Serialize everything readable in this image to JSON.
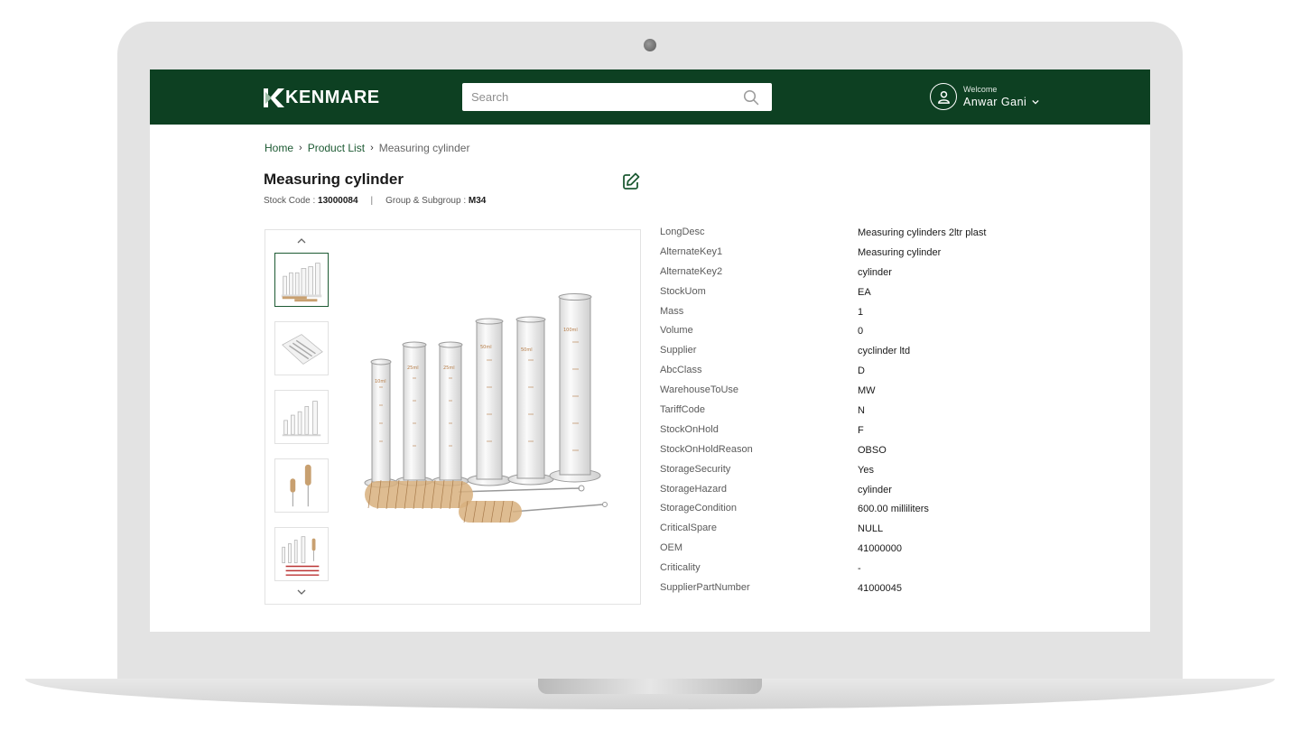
{
  "header": {
    "logo_text": "KENMARE",
    "search_placeholder": "Search",
    "welcome_label": "Welcome",
    "user_name": "Anwar Gani"
  },
  "breadcrumb": {
    "home": "Home",
    "product_list": "Product List",
    "current": "Measuring cylinder"
  },
  "product": {
    "title": "Measuring cylinder",
    "stock_code_label": "Stock Code :",
    "stock_code": "13000084",
    "separator": "|",
    "group_label": "Group & Subgroup :",
    "group": "M34"
  },
  "details": [
    {
      "key": "LongDesc",
      "value": "Measuring cylinders 2ltr plast"
    },
    {
      "key": "AlternateKey1",
      "value": "Measuring cylinder"
    },
    {
      "key": "AlternateKey2",
      "value": "cylinder"
    },
    {
      "key": "StockUom",
      "value": "EA"
    },
    {
      "key": "Mass",
      "value": "1"
    },
    {
      "key": "Volume",
      "value": "0"
    },
    {
      "key": "Supplier",
      "value": "cyclinder ltd"
    },
    {
      "key": "AbcClass",
      "value": "D"
    },
    {
      "key": "WarehouseToUse",
      "value": "MW"
    },
    {
      "key": "TariffCode",
      "value": "N"
    },
    {
      "key": "StockOnHold",
      "value": "F"
    },
    {
      "key": "StockOnHoldReason",
      "value": "OBSO"
    },
    {
      "key": "StorageSecurity",
      "value": "Yes"
    },
    {
      "key": "StorageHazard",
      "value": "cylinder"
    },
    {
      "key": "StorageCondition",
      "value": "600.00  milliliters"
    },
    {
      "key": "CriticalSpare",
      "value": "NULL"
    },
    {
      "key": "OEM",
      "value": "41000000"
    },
    {
      "key": "Criticality",
      "value": "-"
    },
    {
      "key": "SupplierPartNumber",
      "value": "41000045"
    }
  ],
  "colors": {
    "header_bg": "#0d4022",
    "link": "#1d5a33",
    "laptop_frame": "#e3e3e3"
  },
  "icons": [
    "kenmare-logo-icon",
    "search-icon",
    "user-icon",
    "chevron-down-icon",
    "edit-icon",
    "chevron-up-icon"
  ]
}
